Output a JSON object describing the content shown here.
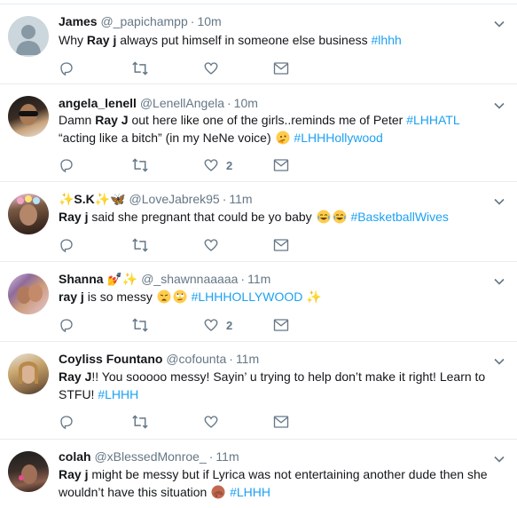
{
  "tweets": [
    {
      "name": "James",
      "handle": "@_papichampp",
      "sep": "·",
      "time": "10m",
      "text": [
        {
          "t": "Why "
        },
        {
          "t": "Ray j",
          "b": true
        },
        {
          "t": " always put himself in someone else business "
        },
        {
          "t": "#lhhh",
          "tag": true
        }
      ],
      "like_count": ""
    },
    {
      "name": "angela_lenell",
      "handle": "@LenellAngela",
      "sep": "·",
      "time": "10m",
      "text": [
        {
          "t": "Damn "
        },
        {
          "t": "Ray J",
          "b": true
        },
        {
          "t": " out here like one of the girls..reminds me of Peter "
        },
        {
          "t": "#LHHATL",
          "tag": true
        },
        {
          "t": " “acting like a bitch” (in my NeNe voice) "
        },
        {
          "emoji": "thinking-emoji"
        },
        {
          "t": " "
        },
        {
          "t": "#LHHHollywood",
          "tag": true
        }
      ],
      "like_count": "2"
    },
    {
      "name": "✨S.K✨🦋",
      "handle": "@LoveJabrek95",
      "sep": "·",
      "time": "11m",
      "text": [
        {
          "t": "Ray j",
          "b": true
        },
        {
          "t": " said she pregnant that could be yo baby "
        },
        {
          "emoji": "laughing-emoji"
        },
        {
          "emoji": "laughing-emoji"
        },
        {
          "t": " "
        },
        {
          "t": "#BasketballWives",
          "tag": true
        }
      ],
      "like_count": ""
    },
    {
      "name": "Shanna 💅✨",
      "handle": "@_shawnnaaaaa",
      "sep": "·",
      "time": "11m",
      "text": [
        {
          "t": "ray j",
          "b": true
        },
        {
          "t": " is so messy "
        },
        {
          "emoji": "weary-emoji"
        },
        {
          "emoji": "eyeroll-emoji"
        },
        {
          "t": " "
        },
        {
          "t": "#LHHHOLLYWOOD",
          "tag": true
        },
        {
          "t": " ✨"
        }
      ],
      "like_count": "2"
    },
    {
      "name": "Coyliss Fountano",
      "handle": "@cofounta",
      "sep": "·",
      "time": "11m",
      "text": [
        {
          "t": "Ray J",
          "b": true
        },
        {
          "t": "!! You sooooo messy! Sayin’ u trying to help don’t make it right! Learn to STFU! "
        },
        {
          "t": "#LHHH",
          "tag": true
        }
      ],
      "like_count": ""
    },
    {
      "name": "colah",
      "handle": "@xBlessedMonroe_",
      "sep": "·",
      "time": "11m",
      "text": [
        {
          "t": "Ray j",
          "b": true
        },
        {
          "t": " might be messy but if Lyrica was not entertaining another dude then she wouldn’t have this situation "
        },
        {
          "emoji": "facepalm-emoji"
        },
        {
          "t": " "
        },
        {
          "t": "#LHHH",
          "tag": true
        }
      ],
      "like_count": ""
    }
  ],
  "colors": {
    "text": "#14171a",
    "muted": "#657786",
    "link": "#1da1f2",
    "divider": "#e6ecf0"
  }
}
